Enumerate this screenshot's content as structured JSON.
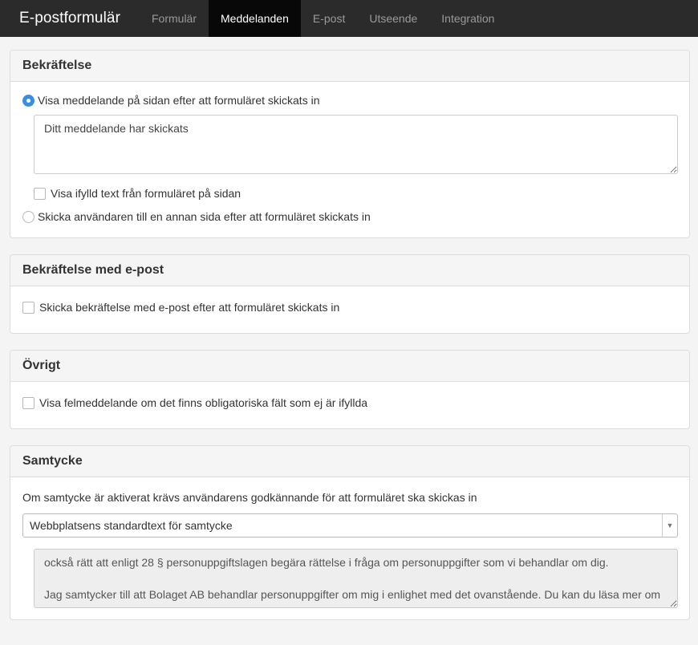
{
  "navbar": {
    "brand": "E-postformulär",
    "tabs": [
      {
        "label": "Formulär",
        "active": false
      },
      {
        "label": "Meddelanden",
        "active": true
      },
      {
        "label": "E-post",
        "active": false
      },
      {
        "label": "Utseende",
        "active": false
      },
      {
        "label": "Integration",
        "active": false
      }
    ]
  },
  "confirmation": {
    "title": "Bekräftelse",
    "option_message_label": "Visa meddelande på sidan efter att formuläret skickats in",
    "option_message_checked": true,
    "message_value": "Ditt meddelande har skickats",
    "show_filled_text_label": "Visa ifylld text från formuläret på sidan",
    "show_filled_text_checked": false,
    "option_redirect_label": "Skicka användaren till en annan sida efter att formuläret skickats in",
    "option_redirect_checked": false
  },
  "email_confirmation": {
    "title": "Bekräftelse med e-post",
    "send_label": "Skicka bekräftelse med e-post efter att formuläret skickats in",
    "send_checked": false
  },
  "other": {
    "title": "Övrigt",
    "show_error_label": "Visa felmeddelande om det finns obligatoriska fält som ej är ifyllda",
    "show_error_checked": false
  },
  "consent": {
    "title": "Samtycke",
    "description": "Om samtycke är aktiverat krävs användarens godkännande för att formuläret ska skickas in",
    "selected_option": "Webbplatsens standardtext för samtycke",
    "text_value": "också rätt att enligt 28 § personuppgiftslagen begära rättelse i fråga om personuppgifter som vi behandlar om dig.\n\nJag samtycker till att Bolaget AB behandlar personuppgifter om mig i enlighet med det ovanstående. Du kan du läsa mer om"
  },
  "colors": {
    "navbar_bg": "#2b2b2b",
    "active_tab_bg": "#080808",
    "radio_accent": "#3b8de0"
  }
}
